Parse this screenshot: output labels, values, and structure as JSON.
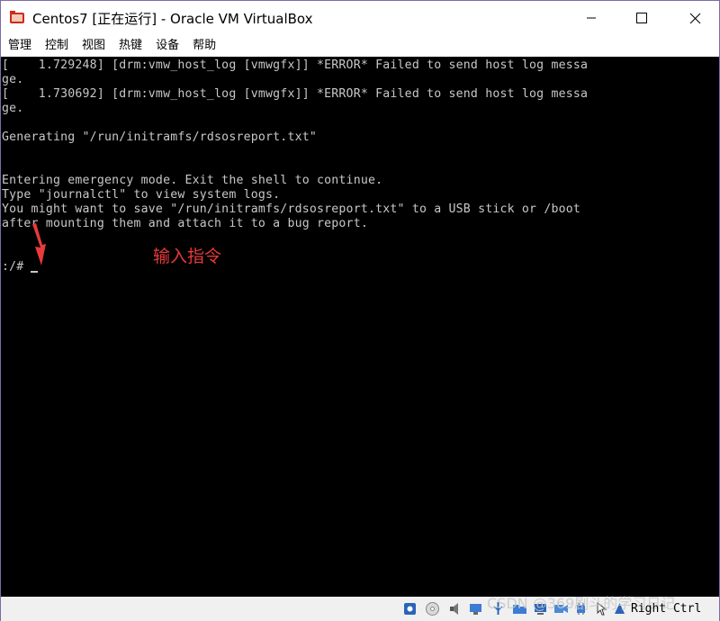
{
  "window": {
    "title": "Centos7 [正在运行] - Oracle VM VirtualBox",
    "icon": "virtualbox-app-icon"
  },
  "menu": [
    "管理",
    "控制",
    "视图",
    "热键",
    "设备",
    "帮助"
  ],
  "console": {
    "lines": [
      "[    1.729248] [drm:vmw_host_log [vmwgfx]] *ERROR* Failed to send host log messa",
      "ge.",
      "[    1.730692] [drm:vmw_host_log [vmwgfx]] *ERROR* Failed to send host log messa",
      "ge.",
      "",
      "Generating \"/run/initramfs/rdsosreport.txt\"",
      "",
      "",
      "Entering emergency mode. Exit the shell to continue.",
      "Type \"journalctl\" to view system logs.",
      "You might want to save \"/run/initramfs/rdsosreport.txt\" to a USB stick or /boot",
      "after mounting them and attach it to a bug report.",
      "",
      "",
      ":/# "
    ],
    "text_color": "#c8c8c8",
    "background": "#000000"
  },
  "annotation": {
    "text": "输入指令",
    "color": "#e83a3a"
  },
  "statusbar": {
    "icons": [
      "hard-disk-icon",
      "optical-drive-icon",
      "audio-icon",
      "network-icon",
      "usb-icon",
      "shared-folders-icon",
      "display-icon",
      "video-capture-icon",
      "cpu-icon",
      "mouse-integration-icon",
      "keyboard-capture-icon"
    ],
    "host_key": "Right Ctrl",
    "watermark": "CSDN @369剧斗的学习日记"
  }
}
